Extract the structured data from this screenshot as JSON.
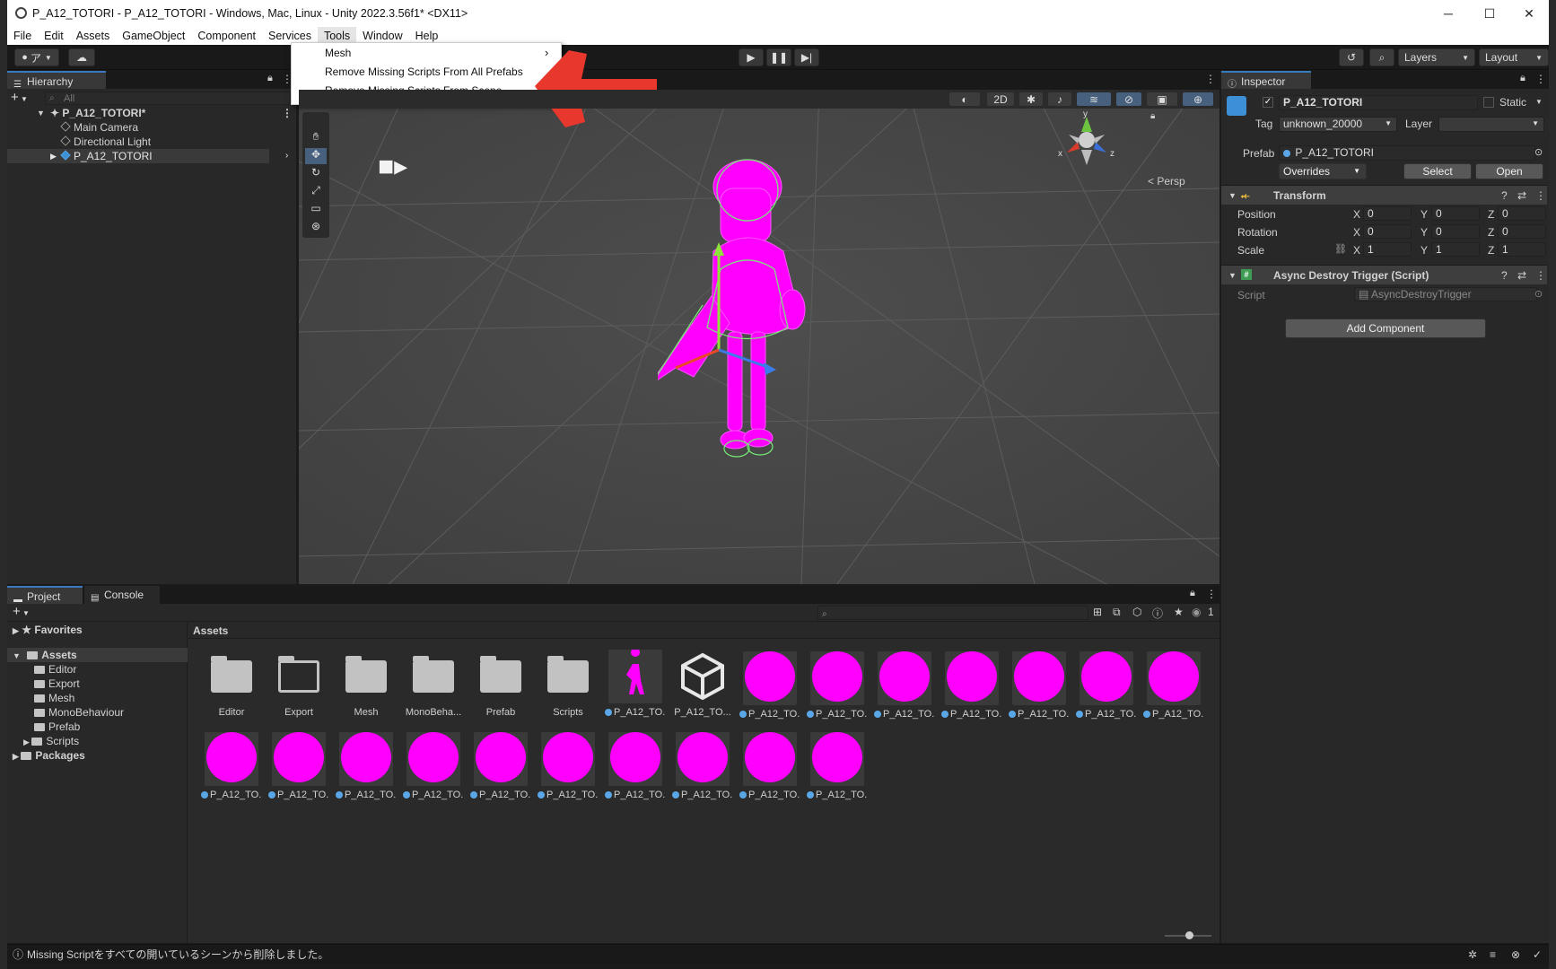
{
  "window": {
    "title": "P_A12_TOTORI - P_A12_TOTORI - Windows, Mac, Linux - Unity 2022.3.56f1* <DX11>",
    "minimize": "─",
    "maximize": "☐",
    "close": "✕"
  },
  "menu": [
    "File",
    "Edit",
    "Assets",
    "GameObject",
    "Component",
    "Services",
    "Tools",
    "Window",
    "Help"
  ],
  "dropdown": {
    "items": [
      "Mesh",
      "Remove Missing Scripts From All Prefabs",
      "Remove Missing Scripts From Scene"
    ],
    "submenu_arrow": "›"
  },
  "toolbar": {
    "account": "ア",
    "layers": "Layers",
    "layout": "Layout"
  },
  "hierarchy": {
    "tab": "Hierarchy",
    "search_placeholder": "All",
    "scene": "P_A12_TOTORI*",
    "items": [
      "Main Camera",
      "Directional Light",
      "P_A12_TOTORI"
    ]
  },
  "scene": {
    "persp": "< Persp",
    "btn_2d": "2D",
    "gizmo_y": "y",
    "gizmo_x": "x",
    "gizmo_z": "z"
  },
  "inspector": {
    "tab": "Inspector",
    "object_name": "P_A12_TOTORI",
    "static_label": "Static",
    "tag_label": "Tag",
    "tag_value": "unknown_20000",
    "layer_label": "Layer",
    "layer_value": "",
    "prefab_label": "Prefab",
    "prefab_value": "P_A12_TOTORI",
    "overrides": "Overrides",
    "select": "Select",
    "open": "Open",
    "transform_title": "Transform",
    "position_label": "Position",
    "rotation_label": "Rotation",
    "scale_label": "Scale",
    "axis_x": "X",
    "axis_y": "Y",
    "axis_z": "Z",
    "position": [
      "0",
      "0",
      "0"
    ],
    "rotation": [
      "0",
      "0",
      "0"
    ],
    "scale": [
      "1",
      "1",
      "1"
    ],
    "script_comp_title": "Async Destroy Trigger (Script)",
    "script_label": "Script",
    "script_value": "AsyncDestroyTrigger",
    "add_component": "Add Component"
  },
  "project": {
    "tab_project": "Project",
    "tab_console": "Console",
    "favorites": "Favorites",
    "assets_root": "Assets",
    "folders": [
      "Editor",
      "Export",
      "Mesh",
      "MonoBehaviour",
      "Prefab",
      "Scripts"
    ],
    "packages": "Packages",
    "breadcrumb": "Assets",
    "hidden_count": "1",
    "asset_labels_row1": [
      "Editor",
      "Export",
      "Mesh",
      "MonoBeha...",
      "Prefab",
      "Scripts",
      "P_A12_TO...",
      "P_A12_TO...",
      "P_A12_TO...",
      "P_A12_TO...",
      "P_A12_TO...",
      "P_A12_TO...",
      "P_A12_TO...",
      "P_A12_TO...",
      "P_A12_TO..."
    ],
    "asset_labels_row2": [
      "P_A12_TO...",
      "P_A12_TO...",
      "P_A12_TO...",
      "P_A12_TO...",
      "P_A12_TO...",
      "P_A12_TO...",
      "P_A12_TO...",
      "P_A12_TO...",
      "P_A12_TO...",
      "P_A12_TO..."
    ]
  },
  "status": {
    "message": "Missing Scriptをすべての開いているシーンから削除しました。"
  },
  "colors": {
    "accent": "#3a79bb",
    "magenta": "#ff00ff",
    "arrow": "#e8372c"
  }
}
